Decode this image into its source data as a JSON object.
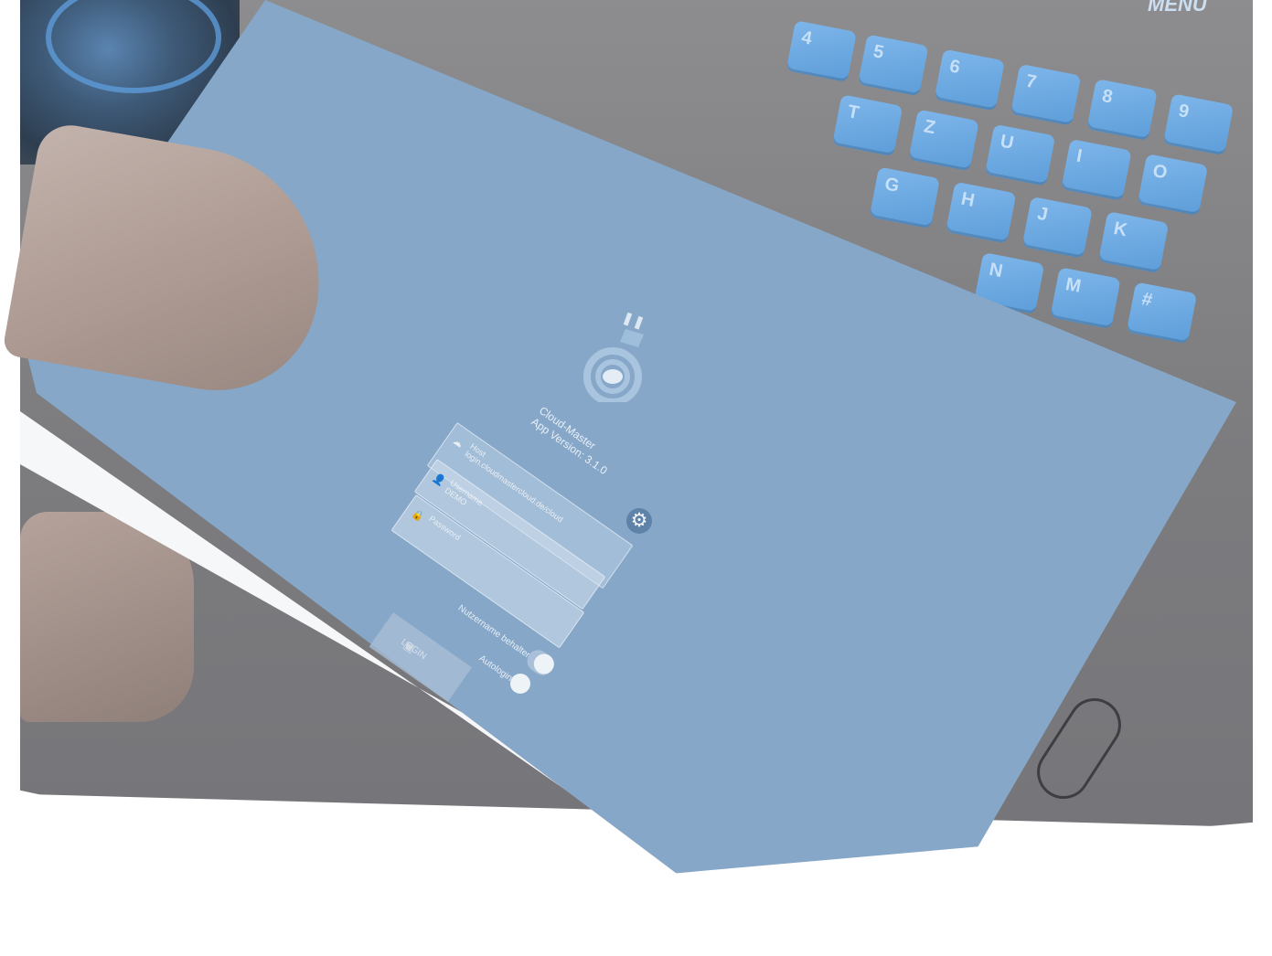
{
  "keyboard": {
    "keys": [
      "4",
      "5",
      "6",
      "7",
      "8",
      "9",
      "T",
      "Z",
      "U",
      "I",
      "O",
      "G",
      "H",
      "J",
      "K",
      "N",
      "M",
      "#"
    ],
    "menu_label": "MENU"
  },
  "app": {
    "name": "Cloud-Master",
    "version": "App Version: 3.1.0"
  },
  "login": {
    "cloud_field": {
      "label": "Host",
      "value": "login.cloudmastercloud.de/cloud"
    },
    "username_field": {
      "label": "Username",
      "value": "DEMO"
    },
    "password_field": {
      "placeholder": "Password"
    },
    "save_username_label": "Nutzername behalten",
    "save_username_on": true,
    "autologin_label": "Autologin",
    "autologin_on": false,
    "login_button_label": "LOGIN"
  },
  "icons": {
    "settings": "gear-icon",
    "cloud": "cloud-icon",
    "user": "user-icon",
    "lock": "lock-icon",
    "logo": "plug-cloud-logo-icon"
  },
  "colors": {
    "screen": "#86a7c8",
    "accent": "#5f82a9",
    "key": "#6aa9e2"
  }
}
